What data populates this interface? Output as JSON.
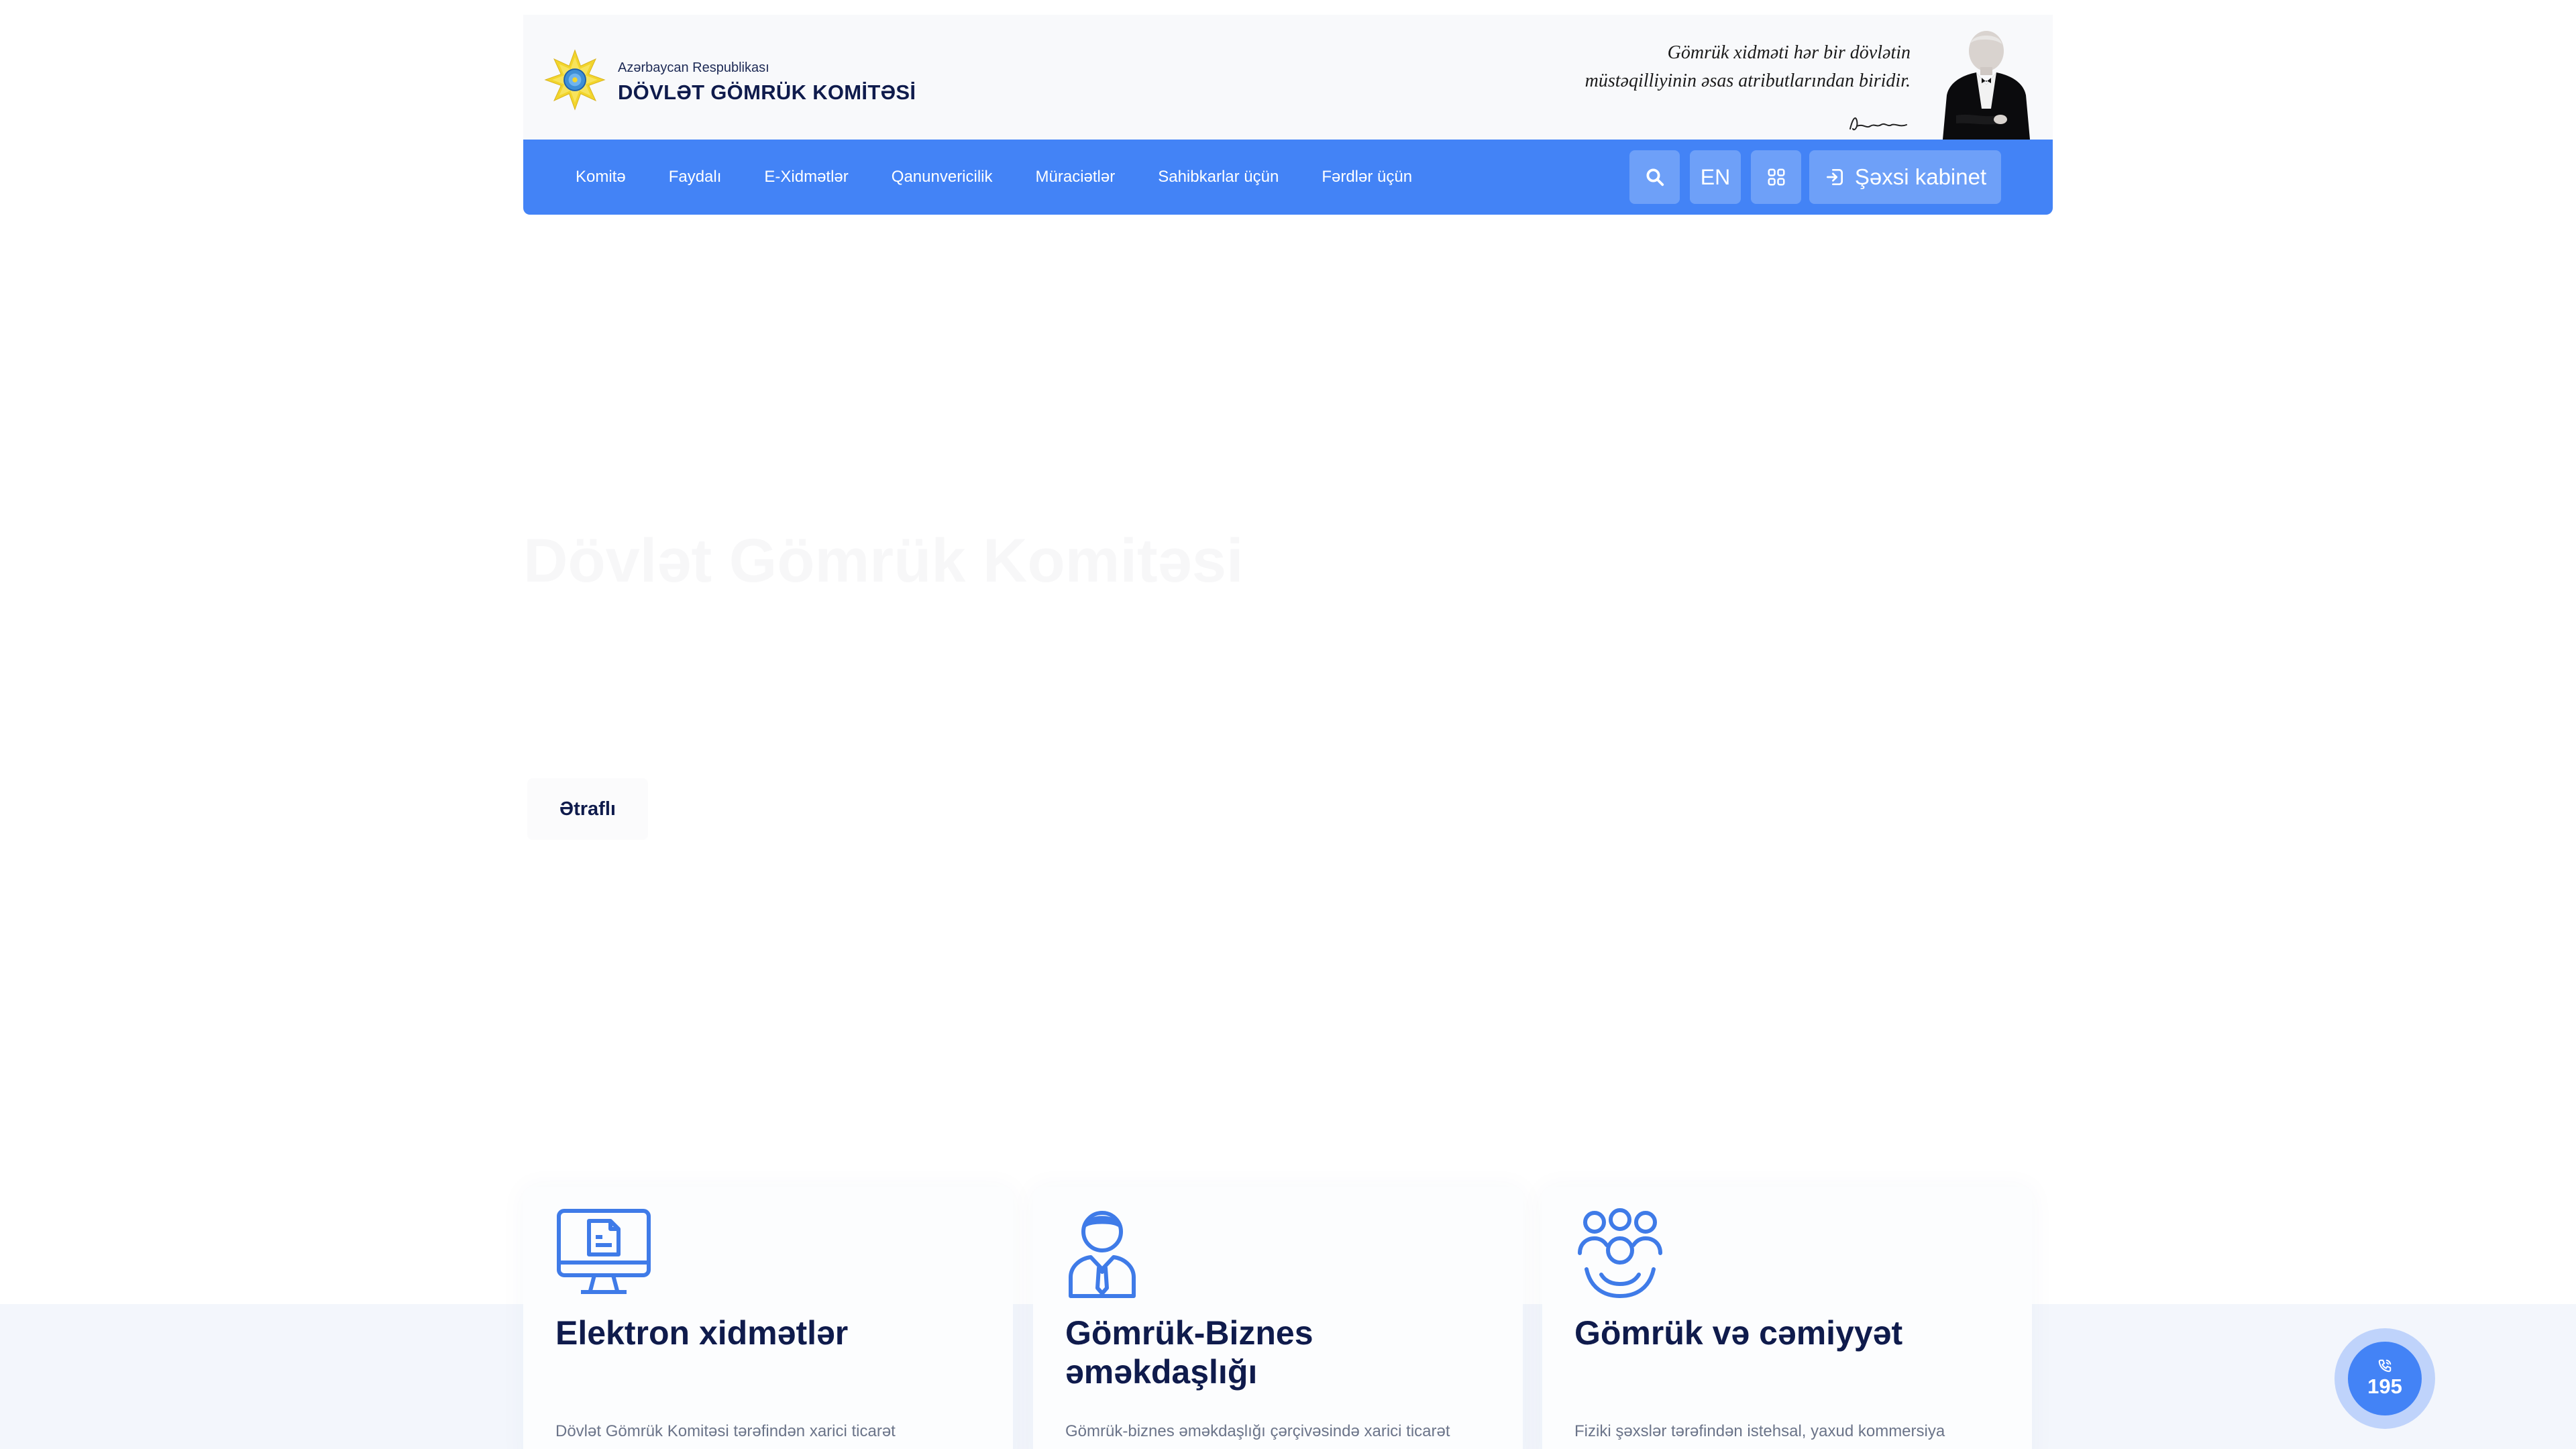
{
  "header": {
    "brand_subtitle": "Azərbaycan Respublikası",
    "brand_title": "DÖVLƏT GÖMRÜK KOMİTƏSİ",
    "quote_line1": "Gömrük xidməti hər bir dövlətin",
    "quote_line2": "müstəqilliyinin əsas atributlarından biridir."
  },
  "nav": {
    "items": [
      {
        "label": "Komitə"
      },
      {
        "label": "Faydalı"
      },
      {
        "label": "E-Xidmətlər"
      },
      {
        "label": "Qanunvericilik"
      },
      {
        "label": "Müraciətlər"
      },
      {
        "label": "Sahibkarlar üçün"
      },
      {
        "label": "Fərdlər üçün"
      }
    ],
    "lang_label": "EN",
    "cabinet_label": "Şəxsi kabinet",
    "search_icon": "search-icon",
    "apps_icon": "grid-icon",
    "login_icon": "login-icon"
  },
  "hero": {
    "title": "Dövlət Gömrük Komitəsi",
    "more_label": "Ətraflı"
  },
  "cards": [
    {
      "icon": "computer-document-icon",
      "title": "Elektron xidmətlər",
      "desc": "Dövlət Gömrük Komitəsi tərəfindən xarici ticarət"
    },
    {
      "icon": "businessman-icon",
      "title": "Gömrük-Biznes əməkdaşlığı",
      "desc": "Gömrük-biznes əməkdaşlığı çərçivəsində xarici ticarət"
    },
    {
      "icon": "community-icon",
      "title": "Gömrük və cəmiyyət",
      "desc": "Fiziki şəxslər tərəfindən istehsal, yaxud kommersiya"
    }
  ],
  "hotline": {
    "number": "195",
    "icon": "phone-icon"
  },
  "colors": {
    "primary": "#4383f6",
    "button": "#6ea0f8",
    "text_dark": "#0f1b4c",
    "header_bg": "#f8f9fb"
  }
}
